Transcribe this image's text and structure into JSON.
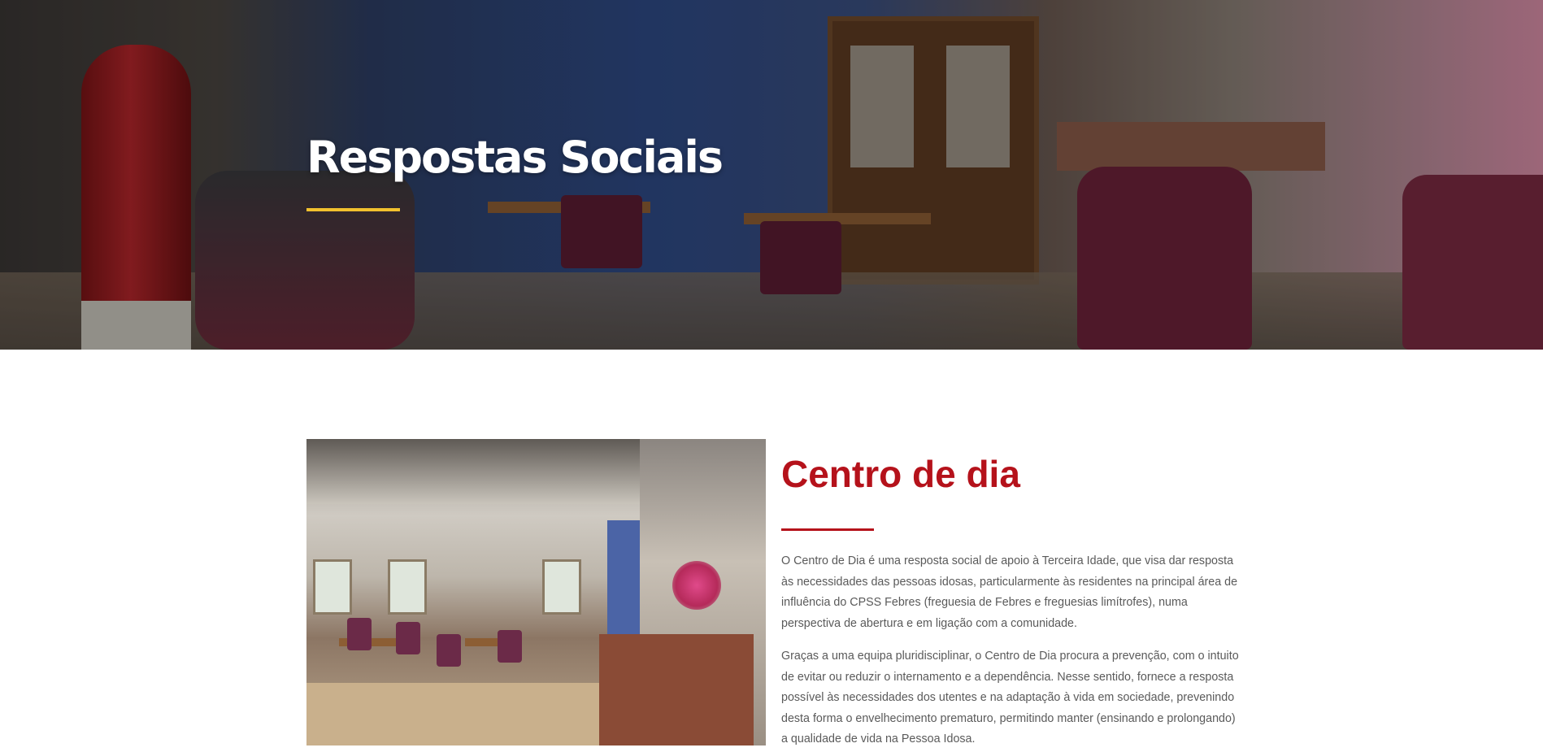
{
  "hero": {
    "title": "Respostas Sociais",
    "accent_color": "#f2c12e"
  },
  "section": {
    "title": "Centro de dia",
    "accent_color": "#b5121b",
    "paragraphs": [
      "O Centro de Dia é uma resposta social de apoio à Terceira Idade, que visa dar resposta às necessidades das pessoas idosas, particularmente às residentes na principal área de influência do CPSS Febres (freguesia de Febres e freguesias limítrofes), numa perspectiva de abertura e em ligação com a comunidade.",
      "Graças a uma equipa pluridisciplinar, o Centro de Dia procura a prevenção, com o intuito de evitar ou reduzir o internamento e a dependência. Nesse sentido, fornece a resposta possível às necessidades dos utentes e na adaptação à vida em sociedade, prevenindo desta forma o envelhecimento prematuro, permitindo manter (ensinando e prolongando) a qualidade de vida na Pessoa Idosa."
    ]
  }
}
